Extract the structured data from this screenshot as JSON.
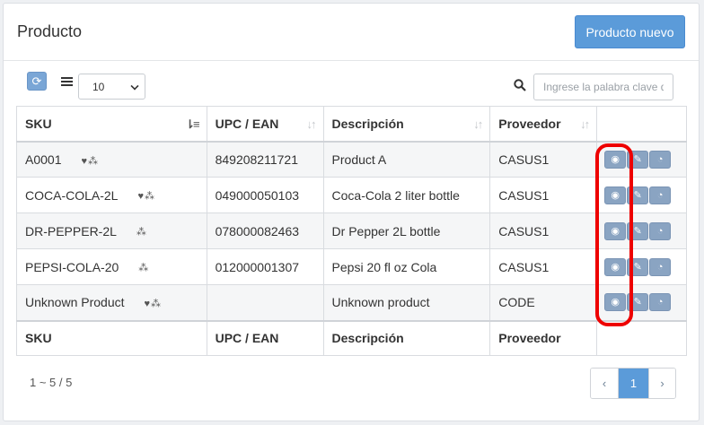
{
  "header": {
    "title": "Producto",
    "new_button": "Producto nuevo"
  },
  "toolbar": {
    "refresh_icon": "refresh-icon",
    "page_size": "10",
    "search_placeholder": "Ingrese la palabra clave d"
  },
  "table": {
    "columns": [
      "SKU",
      "UPC / EAN",
      "Descripción",
      "Proveedor"
    ],
    "rows": [
      {
        "sku": "A0001",
        "icons": "♥⁂",
        "upc": "849208211721",
        "desc": "Product A",
        "prov": "CASUS1"
      },
      {
        "sku": "COCA-COLA-2L",
        "icons": "♥⁂",
        "upc": "049000050103",
        "desc": "Coca-Cola 2 liter bottle",
        "prov": "CASUS1"
      },
      {
        "sku": "DR-PEPPER-2L",
        "icons": "⁂",
        "upc": "078000082463",
        "desc": "Dr Pepper 2L bottle",
        "prov": "CASUS1"
      },
      {
        "sku": "PEPSI-COLA-20",
        "icons": "⁂",
        "upc": "012000001307",
        "desc": "Pepsi 20 fl oz Cola",
        "prov": "CASUS1"
      },
      {
        "sku": "Unknown Product",
        "icons": "♥⁂",
        "upc": "",
        "desc": "Unknown product",
        "prov": "CODE"
      }
    ]
  },
  "pagination": {
    "info": "1 ~ 5 / 5",
    "prev": "‹",
    "current": "1",
    "next": "›"
  },
  "colors": {
    "primary": "#5b9bd9",
    "action": "#8aa4c2",
    "highlight": "#ee0000"
  }
}
